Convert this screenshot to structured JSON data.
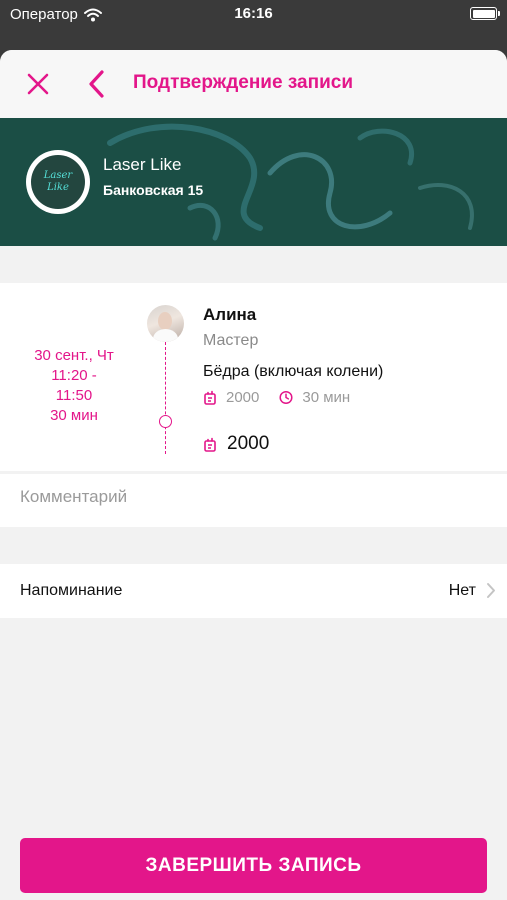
{
  "status_bar": {
    "carrier": "Оператор",
    "time": "16:16",
    "battery_level": 1.0
  },
  "navbar": {
    "title": "Подтверждение записи",
    "close_icon": "close-icon",
    "back_icon": "chevron-left-icon"
  },
  "salon": {
    "logo_line1": "Laser",
    "logo_line2": "Like",
    "name": "Laser Like",
    "address": "Банковская 15"
  },
  "booking": {
    "date": "30 сент., Чт",
    "time_start": "11:20 -",
    "time_end": "11:50",
    "duration": "30 мин",
    "master_name": "Алина",
    "master_role": "Мастер",
    "service_name": "Бёдра (включая колени)",
    "service_price": "2000",
    "service_duration": "30 мин",
    "total": "2000"
  },
  "comment": {
    "placeholder": "Комментарий",
    "value": ""
  },
  "reminder": {
    "label": "Напоминание",
    "value": "Нет"
  },
  "submit": {
    "label": "ЗАВЕРШИТЬ ЗАПИСЬ"
  },
  "colors": {
    "accent": "#e3168a",
    "banner": "#1b4e45",
    "background": "#f2f2f2"
  }
}
